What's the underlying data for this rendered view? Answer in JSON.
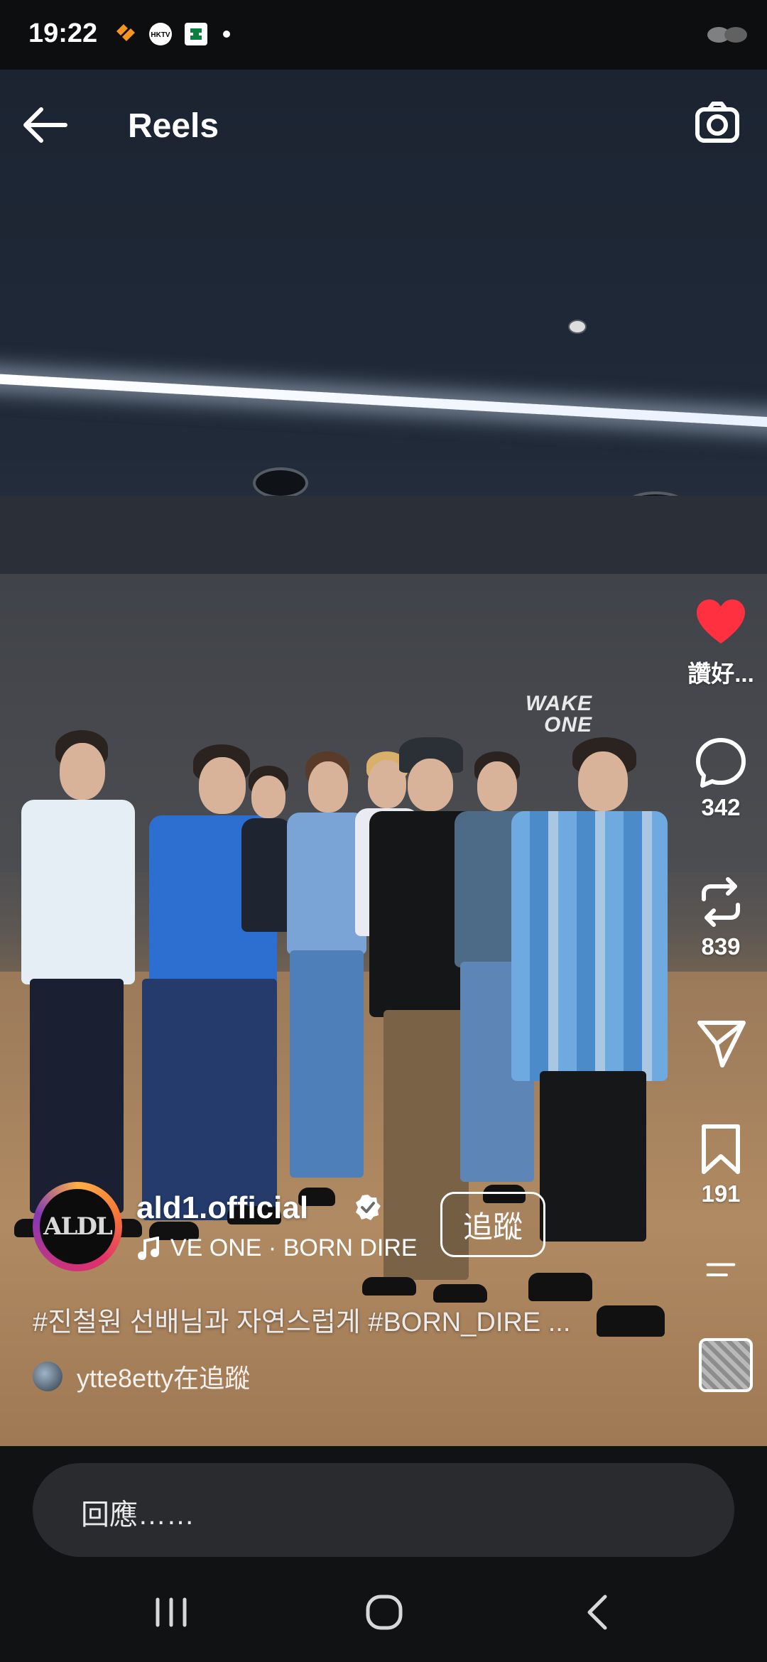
{
  "status_bar": {
    "time": "19:22",
    "icons": [
      "heart-app-icon",
      "hktv-icon",
      "bank-app-icon",
      "dot-icon"
    ],
    "right_icons": [
      "signal-icon"
    ]
  },
  "header": {
    "title": "Reels",
    "back_icon": "arrow-left-icon",
    "camera_icon": "camera-icon"
  },
  "video": {
    "wall_sign": [
      "WAKE",
      "ONE"
    ]
  },
  "actions": {
    "like": {
      "icon": "heart-icon",
      "label": "讚好...",
      "color": "#ff3040",
      "liked": true
    },
    "comment": {
      "icon": "comment-icon",
      "count": "342"
    },
    "repost": {
      "icon": "repost-icon",
      "count": "839"
    },
    "share": {
      "icon": "send-icon"
    },
    "save": {
      "icon": "bookmark-icon",
      "count": "191"
    },
    "more": {
      "icon": "more-icon"
    },
    "audio": {
      "icon": "audio-thumbnail"
    }
  },
  "creator": {
    "avatar_text": "ALDL",
    "username": "ald1.official",
    "verified": true,
    "music": "VE ONE · BORN DIRE",
    "follow_label": "追蹤"
  },
  "caption": "#진철원 선배님과 자연스럽게 #BORN_DIRE ...",
  "followed_by": "ytte8etty在追蹤",
  "reply": {
    "placeholder": "回應……"
  },
  "nav": {
    "recent_icon": "recent-apps-icon",
    "home_icon": "home-icon",
    "back_icon": "back-icon"
  }
}
